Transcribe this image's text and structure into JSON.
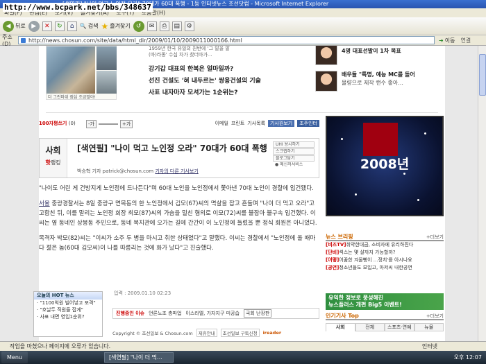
{
  "watermark": "http://www.bcpark.net/bbs/348637",
  "window": {
    "title": "[색연필] \"나이 먹고 노인정 오라\" 70대가 60대 폭행 - 1등 인터넷뉴스 조선닷컴 - Microsoft Internet Explorer"
  },
  "menu": [
    "파일(F)",
    "편집(E)",
    "보기(V)",
    "즐겨찾기(A)",
    "도구(T)",
    "도움말(H)"
  ],
  "toolbar": {
    "back": "뒤로",
    "search": "검색",
    "favorites": "즐겨찾기"
  },
  "address": {
    "label": "주소(D)",
    "url": "http://news.chosun.com/site/data/html_dir/2009/01/10/2009011000166.html",
    "go": "이동",
    "links": "연결"
  },
  "top": {
    "photo_caption": "더 그린마위 점심 조금많아!",
    "sub_lines": [
      "1959년 한국 유일의 원반에 '그 말을 말",
      "(마)라동' 수십 차가 찼더마가..."
    ],
    "headlines": [
      "강기갑 대표의 한복은 얼마일까?",
      "선진 건설도 '혀 내두르는' 쌍용건설의 기술",
      "사표 내자마자 모셔가는 1순위는?"
    ],
    "people": [
      {
        "line1": "4명 대표선발이 1차 목표",
        "line2": ""
      },
      {
        "line1": "배우들 \"특명, 예능 MC를 돌어",
        "line2": "물량으로 제작 캔수 좋아..."
      }
    ]
  },
  "tools": {
    "hits_label": "100자평쓰기",
    "hits_count": "(0)",
    "zoom_minus": "-가",
    "zoom_plus": "+가",
    "email": "이메일",
    "print": "프린트",
    "scrap": "기사목록",
    "rss": "기사원보기",
    "font": "조주인터"
  },
  "article": {
    "section": "사회",
    "hot_prefix": "핫",
    "hot_suffix": "랭킹",
    "title": "[색연필] \"나이 먹고 노인정 오라\" 70대가 60대 폭행",
    "reporter": "박승혁 기자 patrick@chosun.com",
    "reporter_link": "기자의 다른 기사보기",
    "side_items": [
      "UHI 용시하기",
      "스크랩하기",
      "블로그담기",
      "● 메신저서비스"
    ],
    "paragraphs": [
      "\"나이도 어린 게 건방지게 노인정에 드나든다\"며 60대 노인을 노인정에서 쫓아낸 70대 노인이 경찰에 입건됐다.",
      "중랑경찰서는 8일 중랑구 면목동의 한 노인정에서 김모(67)씨의 멱살을 잡고 흔들며 \"나이 더 먹고 오라\"고 고함친 뒤, 이를 말리는 노인정 회장 최모(87)씨의 가슴을 밀친 혐의로 이모(72)씨를 불잡아 불구속 입건했다. 이씨는 옆 동네인 상봉동 주민으로, 동네 복지관에 오가는 길에 간간이 이 노인정에 들렀을 뿐 정식 회원은 아니었다.",
      "목격자 박모(82)씨는 \"이씨가 소주 두 병을 마시고 취한 상태였다\"고 말했다. 이씨는 경찰에서 \"노인정에 올 때마다 젊은 놈(60대 김모씨)이 나를 따름리는 것에 화가 났다\"고 진술했다."
    ],
    "location": "서울",
    "date": "입력 : 2009.01.10 02:23"
  },
  "hot_news": {
    "title": "오늘의 HOT 뉴스",
    "items": [
      "· \"1100억원 빌어넣고 포격\"",
      "· \"호날두 직원들 잡게\"",
      "· 사표 내면 영입1순위?"
    ]
  },
  "issues": {
    "title": "진행중인 이슈",
    "items": [
      "언론노조 총파업",
      "이스라엘, 가자지구 미공습"
    ],
    "boxed": "국회 난장판"
  },
  "footer": {
    "copyright": "Copyright © 조선일보 & Chosun.com",
    "links": [
      "제휴안내",
      "조선일보 구독신청"
    ],
    "ireader": "ireader"
  },
  "right": {
    "banner_year": "2008년",
    "briefing_title": "뉴스 브리핑",
    "more": "+더보기",
    "briefing": [
      {
        "tag": "[비즈TV]",
        "text": "취약한대금, 소비자에 유리하진다"
      },
      {
        "tag": "[단비]",
        "text": "섹스는 몇 살까지 가능할까?"
      },
      {
        "tag": "[어떻]",
        "text": "어꿈한 겨울빵이 ...정치'를 아시나요"
      },
      {
        "tag": "[공연]",
        "text": "청소년들도 모입고, 아저씨 내한공연"
      }
    ],
    "ad_line1": "유익한 정보로 풍성해진",
    "ad_line2": "뉴스플러스 개편 Big5 이벤트!",
    "popular_title": "인기기사 Top",
    "tabs": [
      "사회",
      "전체",
      "스포츠·연예",
      "뉴몰"
    ]
  },
  "status": {
    "text": "작업을 마쳤으나 페이지에 오류가 있습니다.",
    "zone": "인터넷"
  },
  "taskbar": {
    "start": "Menu",
    "item": "[색연필] \"나이 더 먹...",
    "clock": "오후 12:07"
  }
}
